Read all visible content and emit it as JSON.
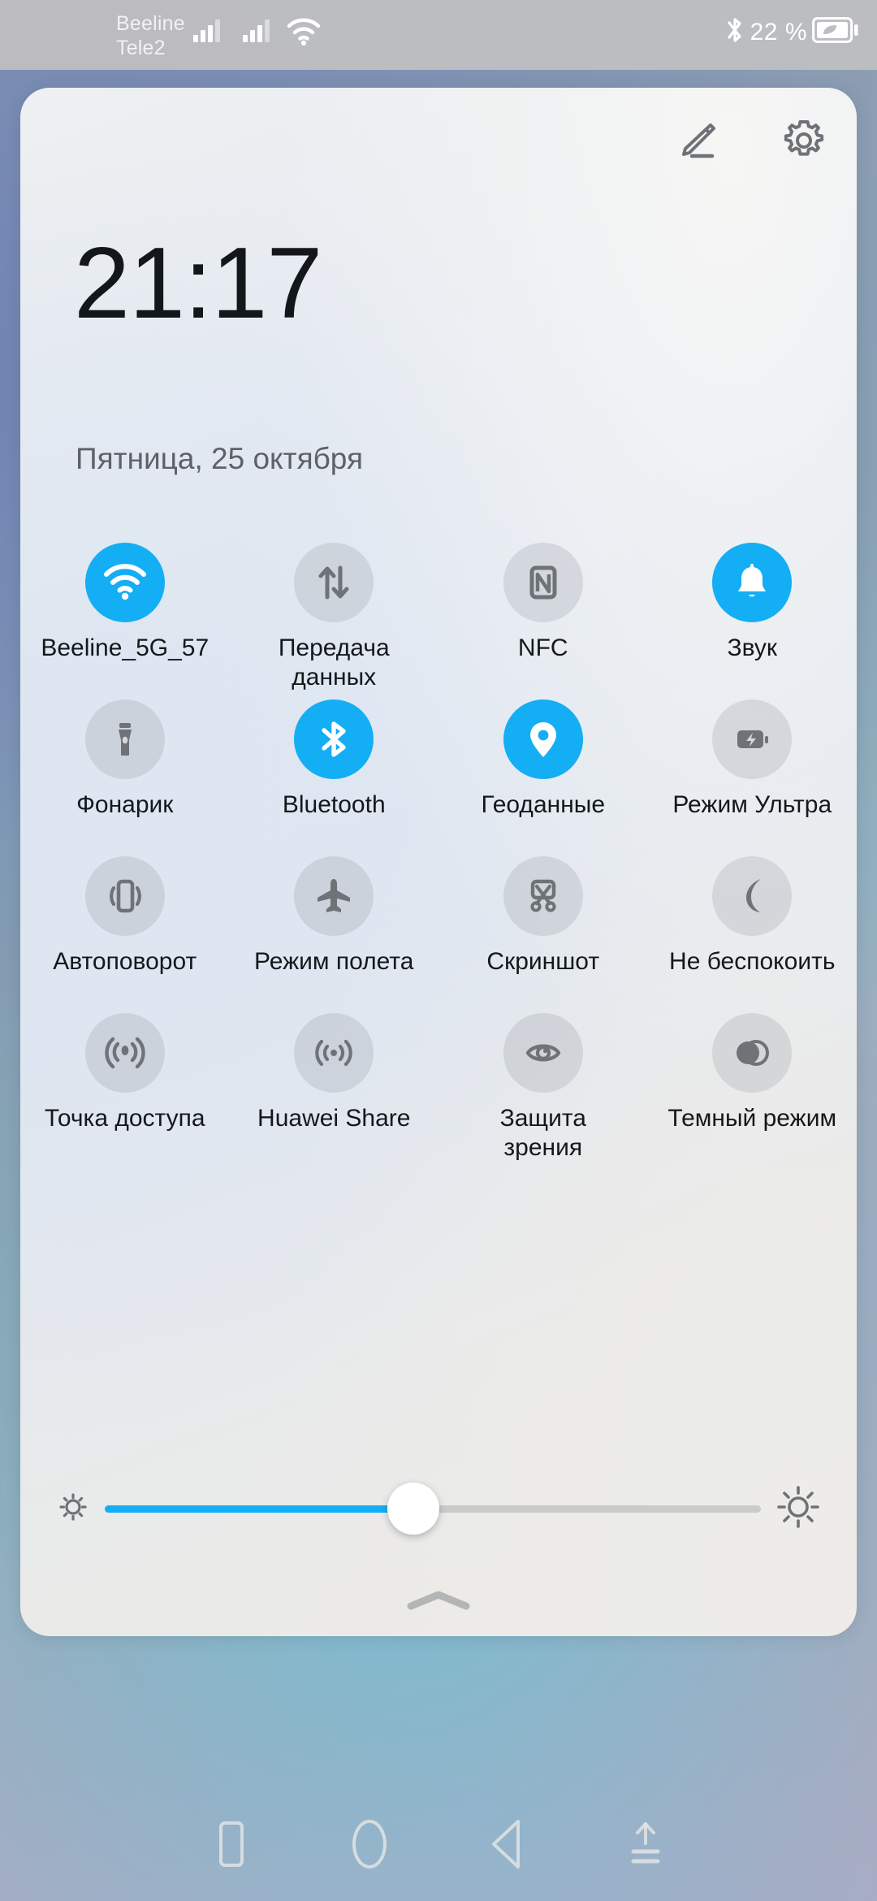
{
  "statusbar": {
    "carriers": [
      "Beeline",
      "Tele2"
    ],
    "signal_icon_1": "signal-bars-icon",
    "signal_icon_2": "signal-bars-icon",
    "wifi_icon": "wifi-icon",
    "bluetooth_icon": "bluetooth-icon",
    "battery_percent": "22 %",
    "battery_icon": "battery-powersaving-leaf-icon"
  },
  "panel": {
    "edit_icon": "edit-pencil-icon",
    "settings_icon": "gear-icon",
    "time": "21:17",
    "date": "Пятница, 25 октября",
    "handle_icon": "chevron-up-icon"
  },
  "colors": {
    "accent_on": "#14aef5",
    "tile_off": "rgba(150,156,163,0.26)",
    "icon_off": "#6f7377",
    "text": "#15181b",
    "date_text": "#5e6166"
  },
  "toggles": [
    {
      "label": "Beeline_5G_57",
      "icon": "wifi-icon",
      "state": "on",
      "name": "toggle-wifi"
    },
    {
      "label": "Передача данных",
      "icon": "data-transfer-icon",
      "state": "off",
      "name": "toggle-mobile-data"
    },
    {
      "label": "NFC",
      "icon": "nfc-icon",
      "state": "off",
      "name": "toggle-nfc"
    },
    {
      "label": "Звук",
      "icon": "bell-icon",
      "state": "on",
      "name": "toggle-sound"
    },
    {
      "label": "Фонарик",
      "icon": "flashlight-icon",
      "state": "off",
      "name": "toggle-flashlight"
    },
    {
      "label": "Bluetooth",
      "icon": "bluetooth-icon",
      "state": "on",
      "name": "toggle-bluetooth"
    },
    {
      "label": "Геоданные",
      "icon": "location-pin-icon",
      "state": "on",
      "name": "toggle-location"
    },
    {
      "label": "Режим Ультра",
      "icon": "battery-bolt-icon",
      "state": "off",
      "name": "toggle-ultra-power-mode"
    },
    {
      "label": "Автоповорот",
      "icon": "auto-rotate-icon",
      "state": "off",
      "name": "toggle-auto-rotate"
    },
    {
      "label": "Режим полета",
      "icon": "airplane-icon",
      "state": "off",
      "name": "toggle-airplane-mode"
    },
    {
      "label": "Скриншот",
      "icon": "screenshot-scissors-icon",
      "state": "off",
      "name": "toggle-screenshot"
    },
    {
      "label": "Не беспокоить",
      "icon": "moon-icon",
      "state": "off",
      "name": "toggle-do-not-disturb"
    },
    {
      "label": "Точка доступа",
      "icon": "hotspot-icon",
      "state": "off",
      "name": "toggle-hotspot"
    },
    {
      "label": "Huawei Share",
      "icon": "huawei-share-icon",
      "state": "off",
      "name": "toggle-huawei-share"
    },
    {
      "label": "Защита зрения",
      "icon": "eye-comfort-icon",
      "state": "off",
      "name": "toggle-eye-comfort"
    },
    {
      "label": "Темный режим",
      "icon": "dark-mode-icon",
      "state": "off",
      "name": "toggle-dark-mode"
    }
  ],
  "brightness": {
    "low_icon": "brightness-low-icon",
    "high_icon": "brightness-high-icon",
    "value_percent": 47
  },
  "navbar": {
    "recents_icon": "recents-square-icon",
    "home_icon": "home-circle-icon",
    "back_icon": "back-triangle-icon",
    "hide_navbar_icon": "hide-navbar-arrow-icon"
  }
}
